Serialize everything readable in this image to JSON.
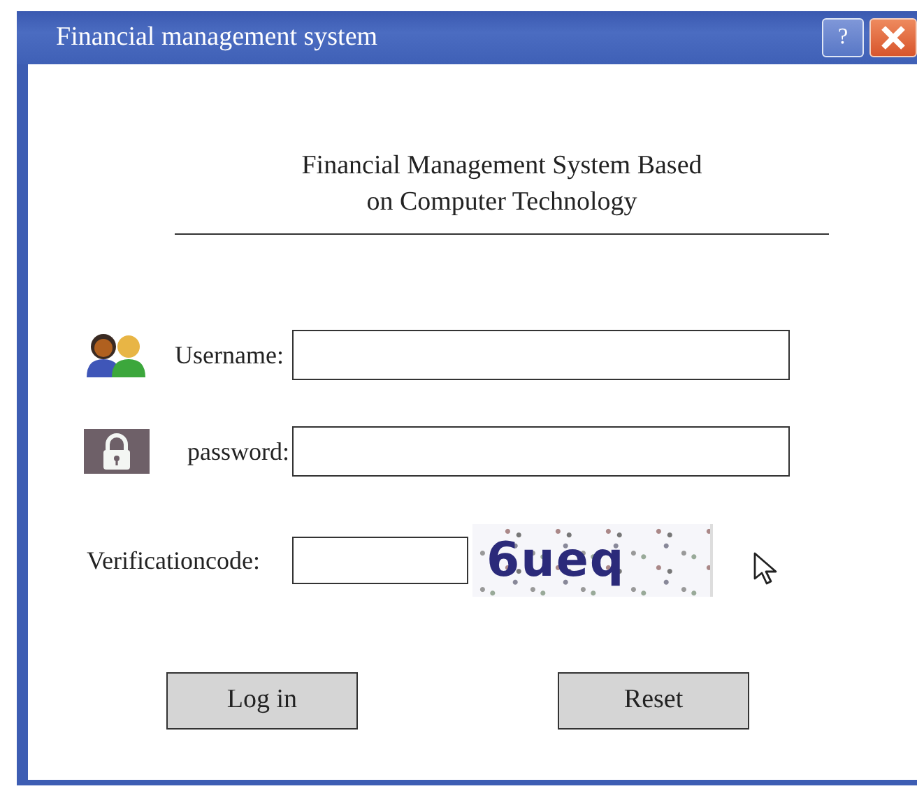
{
  "window": {
    "title": "Financial management system",
    "help_button": "?"
  },
  "heading": {
    "lines": [
      "Financial Management System Based",
      "on Computer Technology"
    ]
  },
  "fields": [
    {
      "kind": "user",
      "label": "Username:"
    },
    {
      "kind": "lock",
      "label": "password:"
    },
    {
      "kind": "captcha",
      "label": "Verificationcode:",
      "captcha": "6ueq"
    }
  ],
  "buttons": [
    {
      "label": "Log in"
    },
    {
      "label": "Reset"
    }
  ]
}
